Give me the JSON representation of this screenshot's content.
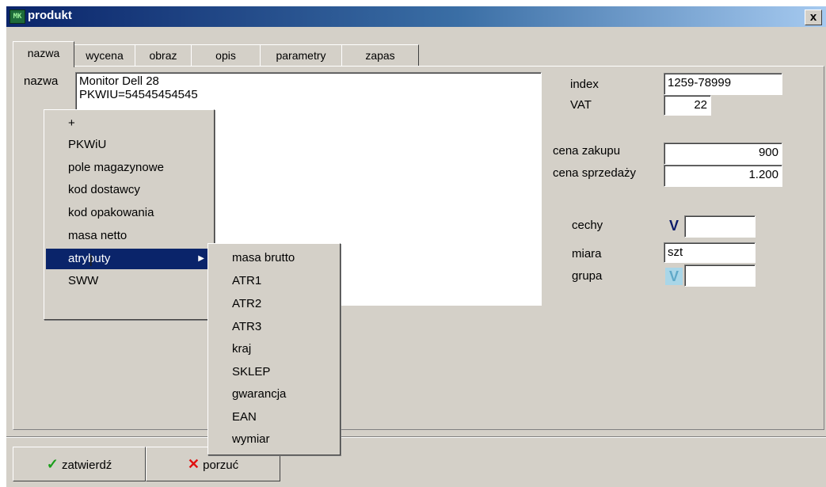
{
  "window": {
    "title": "produkt",
    "icon": "app-icon",
    "icon_text": "MK",
    "close_label": "x"
  },
  "tabs": [
    {
      "label": "nazwa",
      "active": true
    },
    {
      "label": "wycena"
    },
    {
      "label": "obraz"
    },
    {
      "label": "opis"
    },
    {
      "label": "parametry"
    },
    {
      "label": "zapas"
    }
  ],
  "form": {
    "nazwa_label": "nazwa",
    "nazwa_value": "Monitor Dell 28\nPKWIU=54545454545",
    "index_label": "index",
    "index_value": "1259-78999",
    "vat_label": "VAT",
    "vat_value": "22",
    "cena_zakupu_label": "cena zakupu",
    "cena_zakupu_value": "900",
    "cena_sprzedazy_label": "cena sprzedaży",
    "cena_sprzedazy_value": "1.200",
    "cechy_label": "cechy",
    "cechy_value": "",
    "cechy_check": "V",
    "miara_label": "miara",
    "miara_value": "szt",
    "grupa_label": "grupa",
    "grupa_value": "",
    "grupa_check": "V"
  },
  "context_menu": {
    "items": [
      "+",
      "PKWiU",
      "pole magazynowe",
      "kod dostawcy",
      "kod opakowania",
      "masa netto",
      "atrybuty",
      "SWW"
    ],
    "selected": "atrybuty",
    "submenu_arrow": "▶"
  },
  "submenu": {
    "items": [
      "masa brutto",
      "ATR1",
      "ATR2",
      "ATR3",
      "kraj",
      "SKLEP",
      "gwarancja",
      "EAN",
      "wymiar"
    ]
  },
  "buttons": {
    "confirm_label": "zatwierdź",
    "confirm_icon": "✓",
    "cancel_label": "porzuć",
    "cancel_icon": "✕"
  },
  "colors": {
    "title_start": "#0a246a",
    "title_end": "#a6caf0",
    "face": "#d4d0c8",
    "check_green": "#1a9e1a",
    "cross_red": "#e01010"
  }
}
